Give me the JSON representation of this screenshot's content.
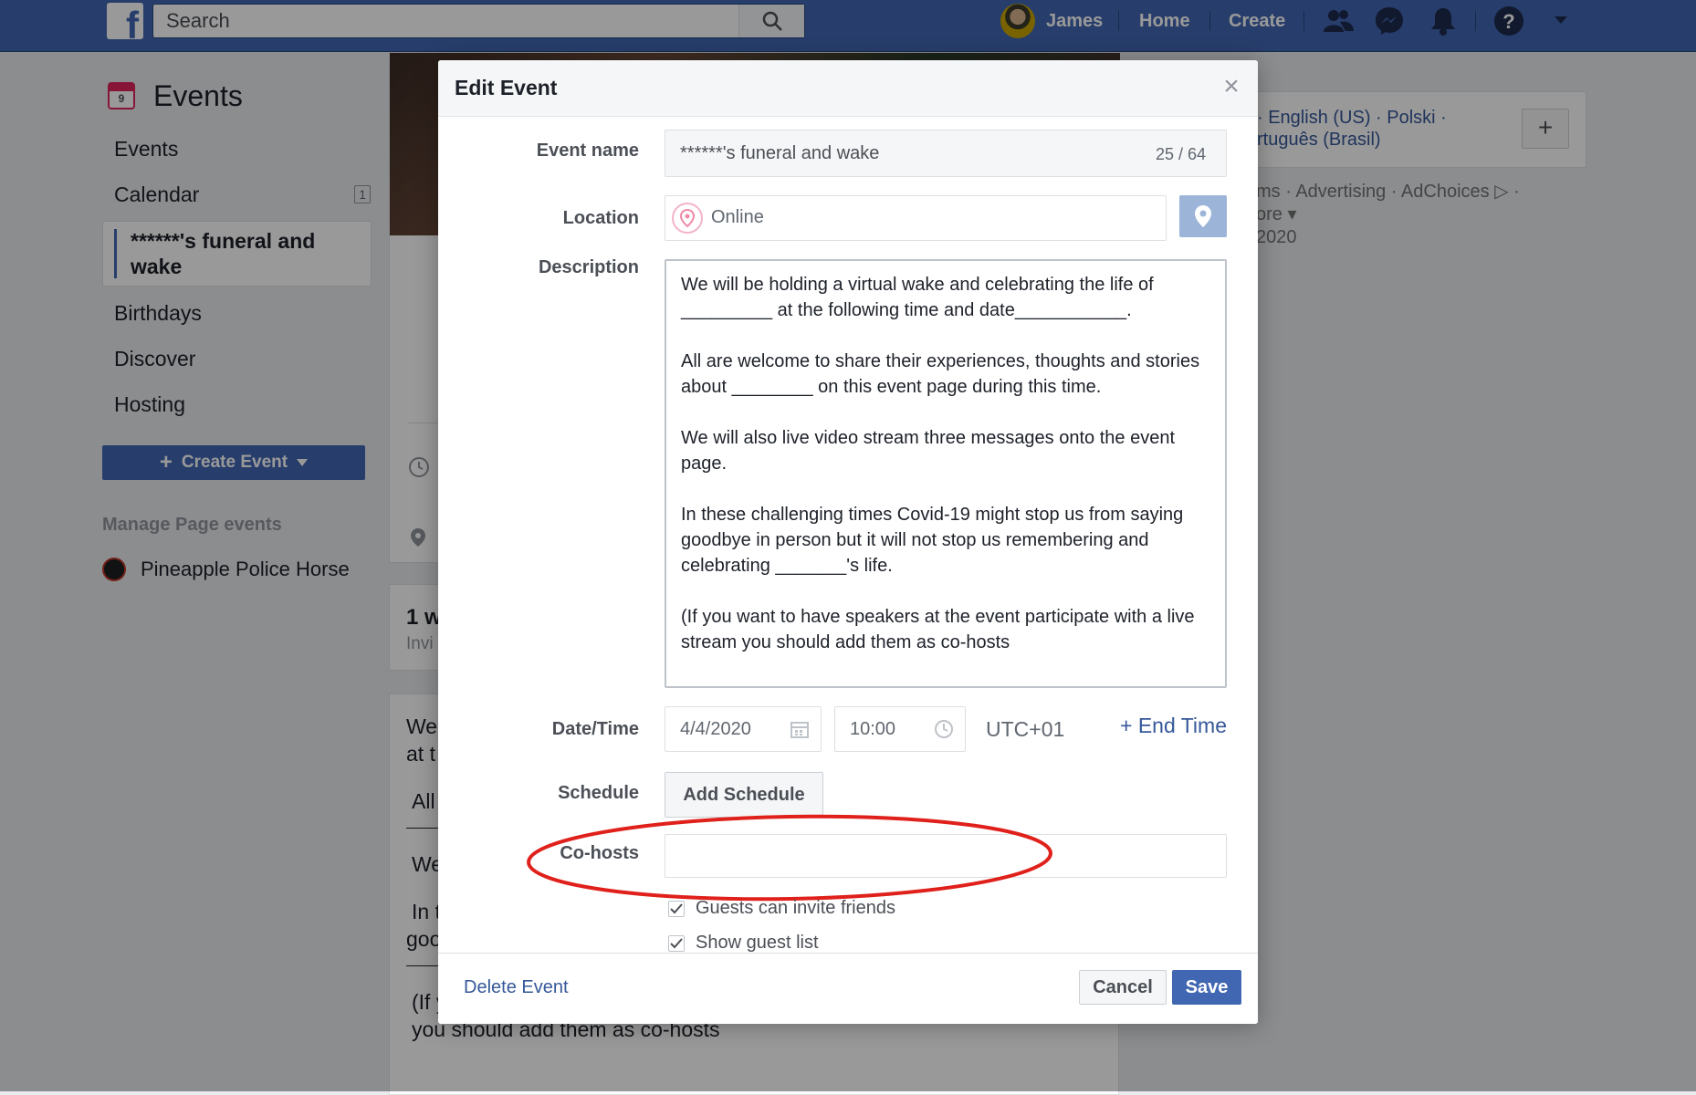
{
  "topbar": {
    "search_placeholder": "Search",
    "user_name": "James",
    "home_label": "Home",
    "create_label": "Create"
  },
  "left_nav": {
    "section_title": "Events",
    "calendar_icon_day": "9",
    "items": [
      {
        "label": "Events"
      },
      {
        "label": "Calendar",
        "count": "1"
      },
      {
        "label": "******'s funeral and wake",
        "active": true
      },
      {
        "label": "Birthdays"
      },
      {
        "label": "Discover"
      },
      {
        "label": "Hosting"
      }
    ],
    "create_event_label": "Create Event",
    "manage_title": "Manage Page events",
    "page_name": "Pineapple Police Horse"
  },
  "background_main": {
    "guests_big": "1 w",
    "guests_small": "Invi",
    "desc_fragments": [
      "We",
      "at t",
      "All",
      "We",
      "In t",
      "goo"
    ],
    "desc_last": "(If you want to have speakers at the event participate with a live stream you should add them as co-hosts"
  },
  "background_right": {
    "lang_line1": "· English (US) · Polski ·",
    "lang_line2": "rtuguês (Brasil)",
    "footer_line1": "ms · Advertising · AdChoices ▷ ·",
    "footer_line2": "ore ▾",
    "footer_line3": "2020"
  },
  "modal": {
    "title": "Edit Event",
    "event_name_label": "Event name",
    "event_name_value": "******'s funeral and wake",
    "event_name_counter": "25 / 64",
    "location_label": "Location",
    "location_value": "Online",
    "description_label": "Description",
    "description_paragraphs": [
      "We will be holding a virtual wake and celebrating the life of _________ at the following time and date___________.",
      "All are welcome to share their experiences, thoughts and stories about ________ on this event page during this time.",
      "We will also live video stream three messages onto the event page.",
      "In these challenging times Covid-19 might stop us from saying goodbye in person but it will not stop us remembering and celebrating _______'s life.",
      "(If you want to have speakers at the event participate with a live stream you should add them as co-hosts"
    ],
    "datetime_label": "Date/Time",
    "date_value": "4/4/2020",
    "time_value": "10:00",
    "timezone": "UTC+01",
    "end_time_label": "+ End Time",
    "schedule_label": "Schedule",
    "add_schedule_label": "Add Schedule",
    "cohosts_label": "Co-hosts",
    "cohosts_value": "",
    "checkbox_invite": "Guests can invite friends",
    "checkbox_guestlist": "Show guest list",
    "delete_label": "Delete Event",
    "cancel_label": "Cancel",
    "save_label": "Save"
  },
  "colors": {
    "brand_blue": "#4267b2",
    "link_blue": "#365899",
    "annotation_red": "#e0201b"
  }
}
